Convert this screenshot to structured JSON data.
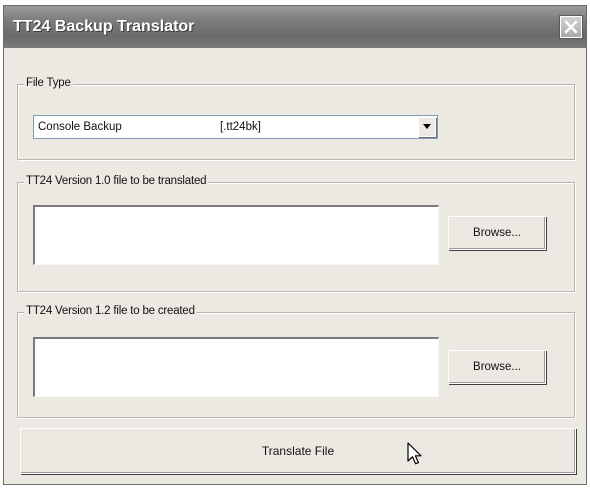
{
  "window": {
    "title": "TT24 Backup Translator",
    "close_icon": "close-icon"
  },
  "file_type": {
    "label": "File Type",
    "selected_name": "Console Backup",
    "selected_ext": "[.tt24bk]",
    "dropdown_icon": "chevron-down-icon"
  },
  "source": {
    "label": "TT24 Version 1.0 file to be translated",
    "value": "",
    "browse_label": "Browse..."
  },
  "target": {
    "label": "TT24 Version 1.2 file to be created",
    "value": "",
    "browse_label": "Browse..."
  },
  "actions": {
    "translate_label": "Translate File"
  },
  "cursor_icon": "mouse-pointer-icon"
}
